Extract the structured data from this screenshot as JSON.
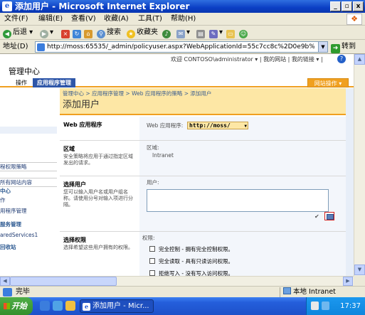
{
  "window": {
    "title": "添加用户 - Microsoft Internet Explorer",
    "minimize": "_",
    "maximize": "▫",
    "close": "x",
    "app_icon": "e"
  },
  "menu": [
    "文件(F)",
    "编辑(E)",
    "查看(V)",
    "收藏(A)",
    "工具(T)",
    "帮助(H)"
  ],
  "toolbar": {
    "back": "后退",
    "search": "搜索",
    "favorites": "收藏夹"
  },
  "address": {
    "label": "地址(D)",
    "url": "http://moss:65535/_admin/policyuser.aspx?WebApplicationId=55c7cc8c%2D0e9b%2D43d5%2Db66f",
    "go": "转到"
  },
  "sharepoint": {
    "welcome": "欢迎 CONTOSO\\administrator ▾  |  我的网站  |  我的链接 ▾  |",
    "help": "?",
    "site_title": "管理中心",
    "tabs": [
      "操作",
      "应用程序管理"
    ],
    "site_actions": "网站操作 ▾",
    "breadcrumb": "管理中心 > 应用程序管理 > Web 应用程序的策略 > 添加用户",
    "page_title": "添加用户",
    "nav": [
      "程权限策略",
      "所有网站内容",
      "中心",
      "作",
      "用程序管理",
      "服务管理",
      "aredServices1",
      "回收站"
    ],
    "sections": {
      "webapp": {
        "title": "Web 应用程序",
        "label": "Web 应用程序:",
        "value": "http://moss/"
      },
      "zone": {
        "title": "区域",
        "desc": "安全策略将应用于通过指定区域发出的请求。",
        "label": "区域:",
        "value": "Intranet"
      },
      "users": {
        "title": "选择用户",
        "desc": "您可以输入用户名或用户组名称。请使用分号对输入项进行分隔。",
        "label": "用户:"
      },
      "permissions": {
        "title": "选择权限",
        "desc": "选择希望这些用户拥有的权限。",
        "label": "权限:",
        "options": [
          "完全控制 - 拥有完全控制权限。",
          "完全读取 - 具有只读访问权限。",
          "拒绝写入 - 没有写入访问权限。"
        ]
      }
    }
  },
  "status": {
    "text": "完毕",
    "zone": "本地 Intranet"
  },
  "taskbar": {
    "start": "开始",
    "task": "添加用户 - Micr...",
    "clock": "17:37"
  },
  "colors": {
    "title_bar": "#0b3fc4",
    "sp_accent": "#f0a020",
    "sp_header_band": "#fde7a5",
    "sp_active_tab": "#2e56a8"
  }
}
